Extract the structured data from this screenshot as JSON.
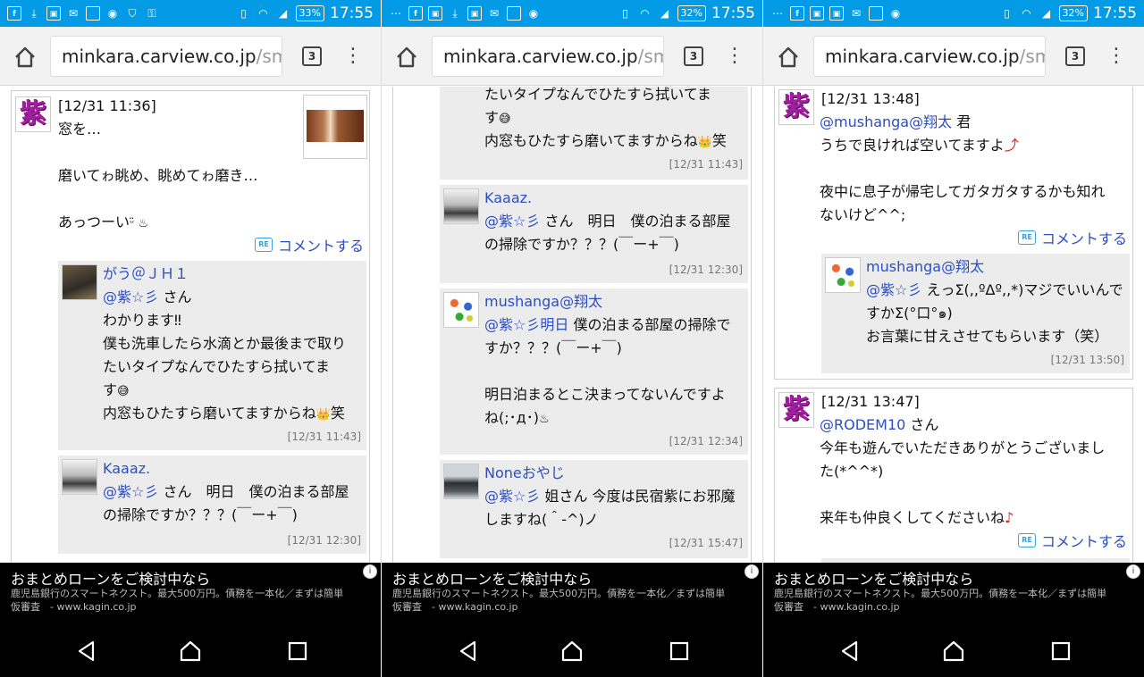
{
  "status": {
    "screens": [
      {
        "battery": "33%",
        "time": "17:55"
      },
      {
        "battery": "32%",
        "time": "17:55"
      },
      {
        "battery": "32%",
        "time": "17:55"
      }
    ]
  },
  "browser": {
    "url_host": "minkara.carview.co.jp",
    "url_path": "/sma",
    "tab_count": "3",
    "menu_glyph": "⋮"
  },
  "ad": {
    "title": "おまとめローンをご検討中なら",
    "desc1": "鹿児島銀行のスマートネクスト。最大500万円。債務を一本化／まずは簡単",
    "desc2": "仮審査　- www.kagin.co.jp",
    "info": "i"
  },
  "comment_button": "コメントする",
  "screen1": {
    "main": {
      "time": "[12/31 11:36]",
      "l1": "窓を…",
      "l2": "磨いてゎ眺め、眺めてゎ磨き…",
      "l3": "あっつーい",
      "l3_emoji": "ᵕ̈ ♨"
    },
    "r1": {
      "name": "がう＠ＪＨ１",
      "mention": "@紫☆彡",
      "san": " さん",
      "l1": "わかります‼",
      "l2": "僕も洗車したら水滴とか最後まで取り",
      "l3": "たいタイプなんでひたすら拭いてま",
      "l4": "す",
      "l4_emoji": "😅",
      "l5": "内窓もひたすら磨いてますからね",
      "l5_emoji": "👑",
      "l5_end": "笑",
      "time": "[12/31 11:43]"
    },
    "r2": {
      "name": "Kaaaz.",
      "mention": "@紫☆彡",
      "l1_rest": " さん　明日　僕の泊まる部屋",
      "l2": "の掃除ですか？？？(￣ー+￣)",
      "time": "[12/31 12:30]"
    }
  },
  "screen2": {
    "top": {
      "l1": "たいタイプなんでひたすら拭いてま",
      "l2": "す",
      "l2_emoji": "😅",
      "l3": "内窓もひたすら磨いてますからね",
      "l3_emoji": "👑",
      "l3_end": "笑",
      "time": "[12/31 11:43]"
    },
    "r1": {
      "name": "Kaaaz.",
      "mention": "@紫☆彡",
      "l1_rest": " さん　明日　僕の泊まる部屋",
      "l2": "の掃除ですか？？？(￣ー+￣)",
      "time": "[12/31 12:30]"
    },
    "r2": {
      "name": "mushanga@翔太",
      "mention": "@紫☆彡明日",
      "l1_rest": " 僕の泊まる部屋の掃除で",
      "l2": "すか？？？(￣ー+￣)",
      "l3": "明日泊まるとこ決まってないんですよ",
      "l4": "ね(;･д･)",
      "l4_emoji": "♨",
      "time": "[12/31 12:34]"
    },
    "r3": {
      "name": "Noneおやじ",
      "mention": "@紫☆彡",
      "l1_rest": " 姐さん 今度は民宿紫にお邪魔",
      "l2": "しますね(＾-^)ノ",
      "time": "[12/31 15:47]"
    }
  },
  "screen3": {
    "c1": {
      "time": "[12/31 13:48]",
      "mention": "@mushanga@翔太",
      "kun": " 君",
      "l1": "うちで良ければ空いてますよ",
      "l1_emoji": "⤴",
      "l2": "夜中に息子が帰宅してガタガタするかも知れ",
      "l3": "ないけど^^;"
    },
    "r1": {
      "name": "mushanga@翔太",
      "mention": "@紫☆彡",
      "l1_rest": " えっΣ(,,ºΔº,,*)マジでいいんで",
      "l2": "すかΣ(°口°๑)",
      "l3": "お言葉に甘えさせてもらいます（笑）",
      "time": "[12/31 13:50]"
    },
    "c2": {
      "time": "[12/31 13:47]",
      "mention": "@RODEM10",
      "san": " さん",
      "l1": "今年も遊んでいただきありがとうございまし",
      "l2": "た(*^^*)",
      "l3": "来年も仲良くしてくださいね",
      "l3_emoji": "♪"
    }
  },
  "avatars": {
    "murasaki": "紫"
  }
}
